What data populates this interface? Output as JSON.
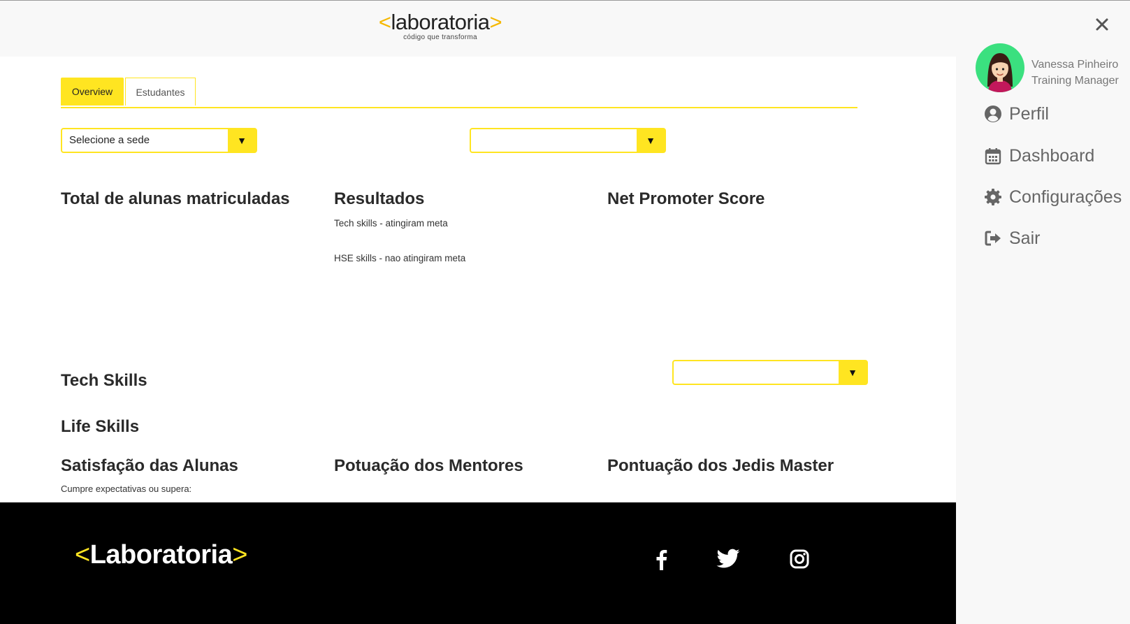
{
  "brand": {
    "name": "laboratoria",
    "tagline": "código que transforma",
    "footer_name": "Laboratoria",
    "bracket_open": "<",
    "bracket_close": ">"
  },
  "colors": {
    "accent": "#ffe521",
    "brand_orange": "#f5b800",
    "footer_bg": "#000000",
    "avatar_bg": "#3be07f"
  },
  "tabs": [
    {
      "label": "Overview",
      "active": true
    },
    {
      "label": "Estudantes",
      "active": false
    }
  ],
  "filters": {
    "sede": {
      "value": "Selecione a sede"
    },
    "second": {
      "value": ""
    },
    "skills": {
      "value": ""
    }
  },
  "sections": {
    "total": {
      "title": "Total de alunas matriculadas"
    },
    "resultados": {
      "title": "Resultados",
      "tech": "Tech skills - atingiram meta",
      "hse": "HSE skills - nao atingiram meta"
    },
    "nps": {
      "title": "Net Promoter Score"
    },
    "tech_skills": {
      "title": "Tech Skills"
    },
    "life_skills": {
      "title": "Life Skills"
    },
    "satisfacao": {
      "title": "Satisfação das Alunas",
      "subtitle": "Cumpre expectativas ou supera:"
    },
    "mentores": {
      "title": "Potuação dos Mentores"
    },
    "jedis": {
      "title": "Pontuação dos Jedis Master"
    }
  },
  "sidebar": {
    "user": {
      "name": "Vanessa Pinheiro",
      "role": "Training Manager"
    },
    "menu": [
      {
        "label": "Perfil",
        "icon": "user-circle-icon"
      },
      {
        "label": "Dashboard",
        "icon": "calendar-icon"
      },
      {
        "label": "Configurações",
        "icon": "gear-icon"
      },
      {
        "label": "Sair",
        "icon": "sign-out-icon"
      }
    ]
  },
  "footer": {
    "social": [
      "facebook-icon",
      "twitter-icon",
      "instagram-icon"
    ]
  }
}
